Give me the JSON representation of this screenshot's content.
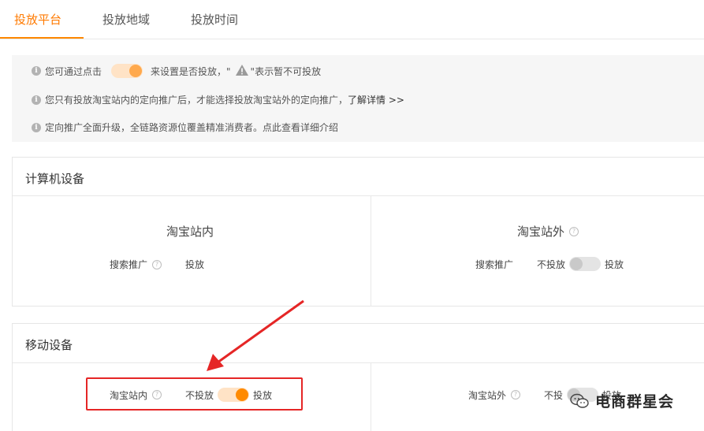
{
  "tabs": [
    {
      "label": "投放平台",
      "active": true
    },
    {
      "label": "投放地域",
      "active": false
    },
    {
      "label": "投放时间",
      "active": false
    }
  ],
  "notice": {
    "line1_prefix": "您可通过点击",
    "line1_middle": "来设置是否投放，\"",
    "line1_suffix": "\"表示暂不可投放",
    "line2": "您只有投放淘宝站内的定向推广后，才能选择投放淘宝站外的定向推广，",
    "line2_link": "了解详情 >>",
    "line3": "定向推广全面升级，全链路资源位覆盖精准消费者。点此查看详细介绍"
  },
  "pc_section": {
    "title": "计算机设备",
    "inside": {
      "title": "淘宝站内",
      "row_label": "搜索推广",
      "status": "投放"
    },
    "outside": {
      "title": "淘宝站外",
      "row_label": "搜索推广",
      "off_label": "不投放",
      "on_label": "投放",
      "toggle_on": false
    }
  },
  "mobile_section": {
    "title": "移动设备",
    "inside": {
      "label": "淘宝站内",
      "off_label": "不投放",
      "on_label": "投放",
      "toggle_on": true
    },
    "outside": {
      "label": "淘宝站外",
      "off_label": "不投",
      "on_label": "投放",
      "toggle_on": false
    }
  },
  "watermark": {
    "text": "电商群星会",
    "icon": "wechat-icon"
  },
  "colors": {
    "accent": "#ff8a00",
    "annotation": "#e52626"
  }
}
